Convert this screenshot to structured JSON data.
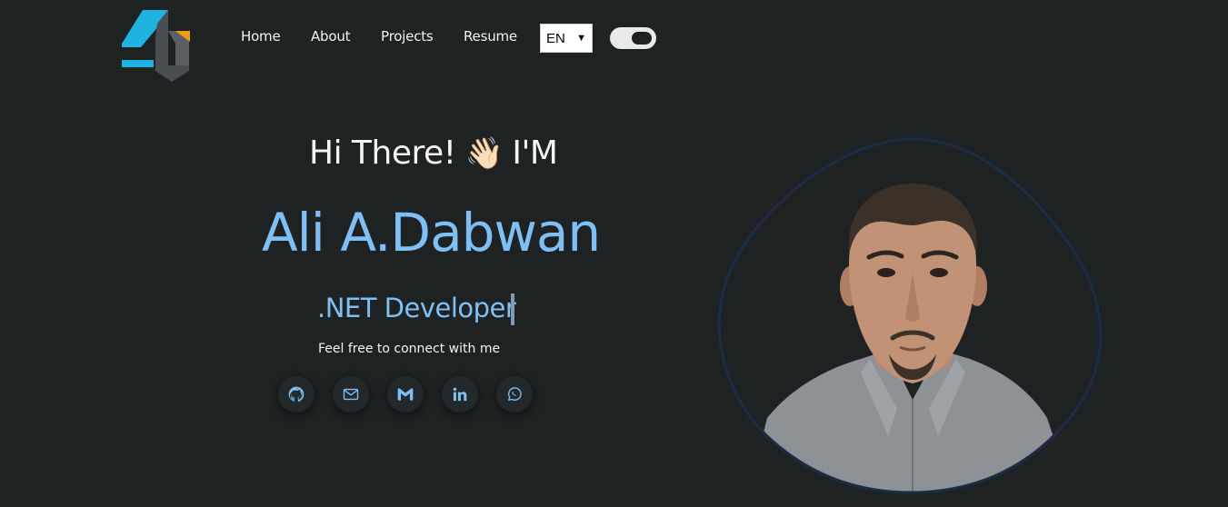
{
  "nav": {
    "logo": "logo-icon",
    "links": [
      {
        "label": "Home"
      },
      {
        "label": "About"
      },
      {
        "label": "Projects"
      },
      {
        "label": "Resume"
      }
    ],
    "language": {
      "selected": "EN"
    },
    "theme_toggle": {
      "state": "on"
    }
  },
  "hero": {
    "greeting": "Hi There!",
    "greeting_emoji": "👋🏻",
    "greeting_suffix": "I'M",
    "name": "Ali A.Dabwan",
    "role": ".NET Developer",
    "connect_text": "Feel free to connect with me",
    "socials": [
      {
        "icon": "github-icon"
      },
      {
        "icon": "mail-icon"
      },
      {
        "icon": "gmail-icon"
      },
      {
        "icon": "linkedin-icon"
      },
      {
        "icon": "whatsapp-icon"
      }
    ]
  },
  "profile_photo": {
    "icon": "profile-photo"
  },
  "colors": {
    "background": "#1f2223",
    "accent": "#7ec0f5",
    "blob_outline": "#1b2d45"
  }
}
